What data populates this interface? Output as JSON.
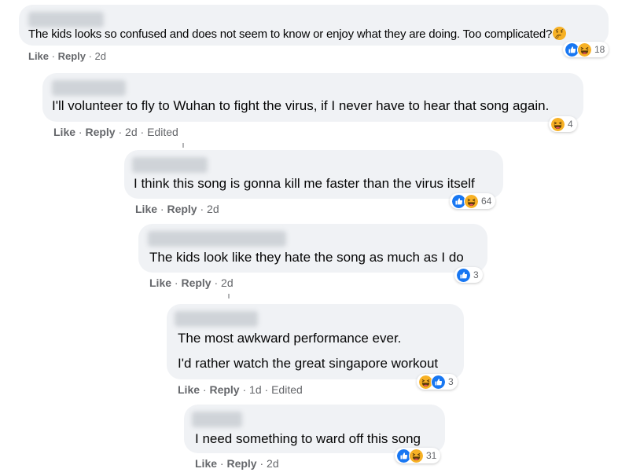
{
  "comments": [
    {
      "text": "The kids looks so confused and does not seem to know or enjoy what they are doing. Too complicated?",
      "like": "Like",
      "reply": "Reply",
      "time": "2d",
      "reaction_count": "18"
    },
    {
      "text": "I'll volunteer to fly to Wuhan to fight the virus, if I never have to hear that song again.",
      "like": "Like",
      "reply": "Reply",
      "time": "2d",
      "edited": "Edited",
      "reaction_count": "4"
    },
    {
      "text": "I think this song is gonna kill me faster than the virus itself",
      "like": "Like",
      "reply": "Reply",
      "time": "2d",
      "reaction_count": "64"
    },
    {
      "text": "The kids look like they hate the song as much as I do",
      "like": "Like",
      "reply": "Reply",
      "time": "2d",
      "reaction_count": "3"
    },
    {
      "text_line1": "The most awkward performance ever.",
      "text_line2": "I'd rather watch the great singapore workout",
      "like": "Like",
      "reply": "Reply",
      "time": "1d",
      "edited": "Edited",
      "reaction_count": "3"
    },
    {
      "text": "I need something to ward off this song",
      "like": "Like",
      "reply": "Reply",
      "time": "2d",
      "reaction_count": "31"
    }
  ],
  "separator": " · ",
  "colors": {
    "like_blue": "#1877f2",
    "haha_yellow": "#f7b125",
    "bubble_bg": "#f0f2f5",
    "meta_gray": "#65676b"
  }
}
